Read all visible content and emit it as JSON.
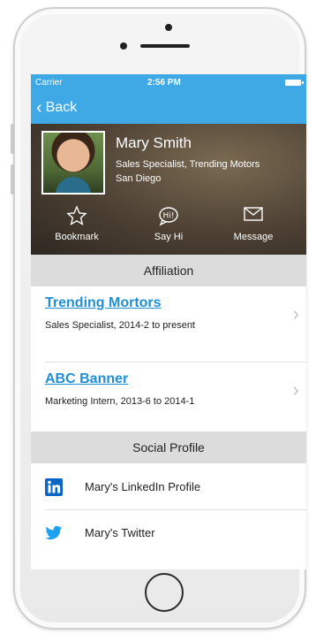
{
  "status_bar": {
    "carrier": "Carrier",
    "time": "2:56 PM"
  },
  "nav": {
    "back_label": "Back"
  },
  "profile": {
    "name": "Mary Smith",
    "subtitle_line1": "Sales Specialist, Trending Motors",
    "subtitle_line2": "San Diego"
  },
  "actions": [
    {
      "label": "Bookmark",
      "icon": "star-icon"
    },
    {
      "label": "Say Hi",
      "icon": "hi-bubble-icon"
    },
    {
      "label": "Message",
      "icon": "envelope-icon"
    }
  ],
  "affiliation": {
    "header": "Affiliation",
    "items": [
      {
        "title": "Trending Mortors",
        "description": "Sales Specialist, 2014-2 to present"
      },
      {
        "title": "ABC Banner",
        "description": "Marketing Intern, 2013-6 to 2014-1"
      }
    ]
  },
  "social": {
    "header": "Social Profile",
    "items": [
      {
        "label": "Mary's LinkedIn Profile",
        "icon": "linkedin-icon"
      },
      {
        "label": "Mary's Twitter",
        "icon": "twitter-icon"
      }
    ]
  },
  "colors": {
    "accent": "#3fa9e6",
    "link": "#1e8fd8",
    "section_bg": "#dcdcdc",
    "linkedin": "#0a66c2",
    "twitter": "#1da1f2"
  }
}
